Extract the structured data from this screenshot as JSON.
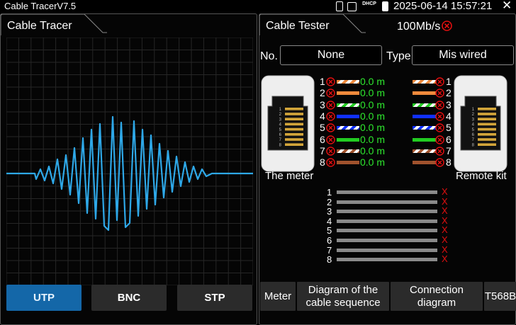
{
  "status_bar": {
    "app_title": "Cable TracerV7.5",
    "dhcp_label": "DHCP",
    "datetime": "2025-06-14 15:57:21",
    "close_glyph": "✕",
    "icons": [
      "sd-card-icon",
      "image-icon",
      "dhcp-icon",
      "battery-icon"
    ]
  },
  "left_panel": {
    "tab_title": "Cable Tracer",
    "mode_buttons": [
      {
        "label": "UTP",
        "active": true
      },
      {
        "label": "BNC",
        "active": false
      },
      {
        "label": "STP",
        "active": false
      }
    ]
  },
  "right_panel": {
    "tab_title": "Cable Tester",
    "speed": "100Mb/s",
    "no_label": "No.",
    "no_value": "None",
    "type_label": "Type",
    "type_value": "Mis wired",
    "meter_label": "The meter",
    "remote_label": "Remote kit",
    "wires": [
      {
        "pin": "1",
        "length": "0.0 m",
        "color": "#f08a3c",
        "striped": true
      },
      {
        "pin": "2",
        "length": "0.0 m",
        "color": "#f08a3c",
        "striped": false
      },
      {
        "pin": "3",
        "length": "0.0 m",
        "color": "#22cc22",
        "striped": true
      },
      {
        "pin": "4",
        "length": "0.0 m",
        "color": "#1030ff",
        "striped": false
      },
      {
        "pin": "5",
        "length": "0.0 m",
        "color": "#1030ff",
        "striped": true
      },
      {
        "pin": "6",
        "length": "0.0 m",
        "color": "#22cc22",
        "striped": false
      },
      {
        "pin": "7",
        "length": "0.0 m",
        "color": "#a0522d",
        "striped": true
      },
      {
        "pin": "8",
        "length": "0.0 m",
        "color": "#a0522d",
        "striped": false
      }
    ],
    "jack_pins": [
      "1",
      "2",
      "3",
      "4",
      "5",
      "6",
      "7",
      "8"
    ],
    "sequence_pins": [
      "1",
      "2",
      "3",
      "4",
      "5",
      "6",
      "7",
      "8"
    ],
    "sequence_mark": "X",
    "bottom_tabs": [
      {
        "label": "Meter"
      },
      {
        "label": "Diagram of the cable sequence"
      },
      {
        "label": "Connection diagram"
      },
      {
        "label": "T568B"
      }
    ]
  },
  "colors": {
    "accent_blue": "#1467a8",
    "trace": "#2ea8e8",
    "length_green": "#2ee82e",
    "error_red": "#e01010"
  }
}
